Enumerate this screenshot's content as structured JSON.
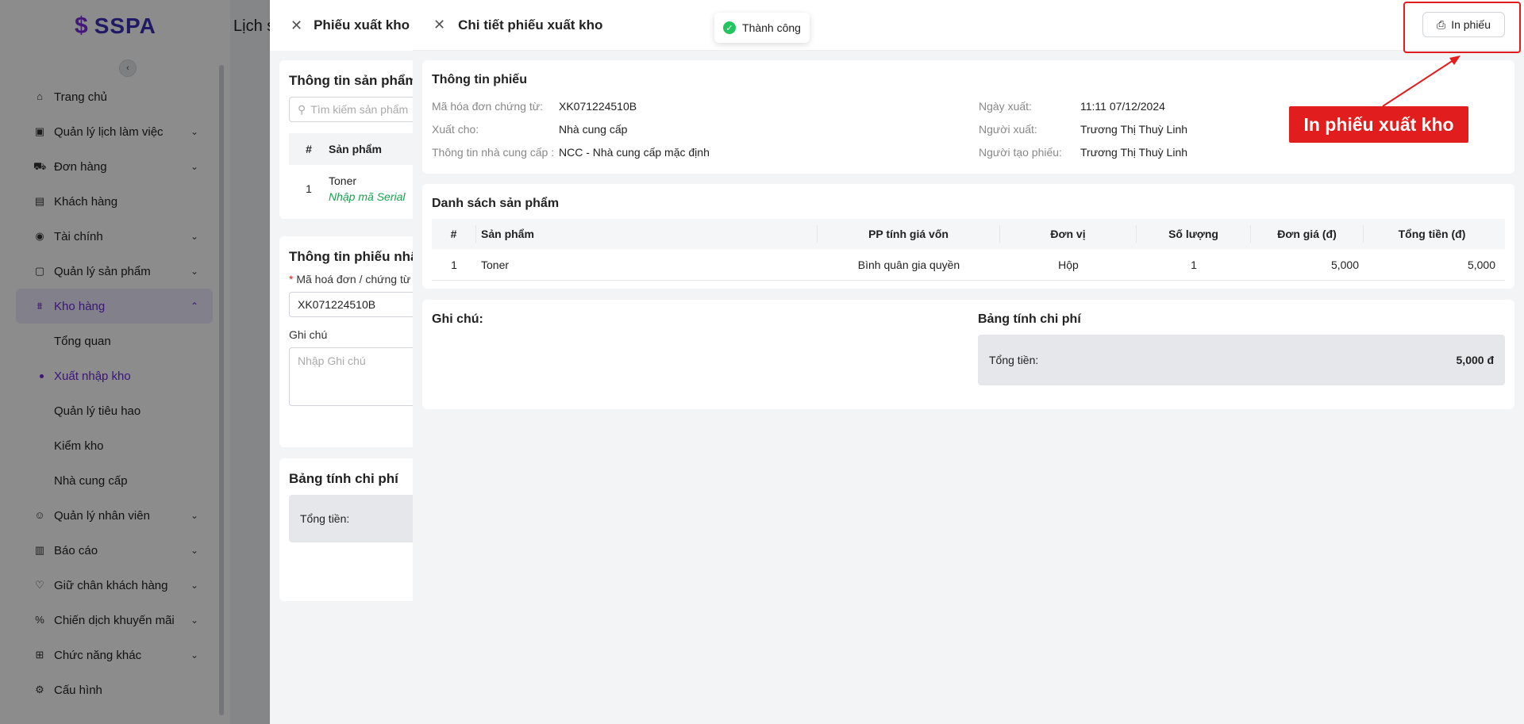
{
  "brand": {
    "name": "SSPA"
  },
  "page": {
    "title": "Lịch s"
  },
  "sidebar": {
    "items": [
      {
        "label": "Trang chủ",
        "icon": "home-icon",
        "chevron": false
      },
      {
        "label": "Quản lý lịch làm việc",
        "icon": "calendar-icon",
        "chevron": true
      },
      {
        "label": "Đơn hàng",
        "icon": "cart-icon",
        "chevron": true
      },
      {
        "label": "Khách hàng",
        "icon": "id-card-icon",
        "chevron": false
      },
      {
        "label": "Tài chính",
        "icon": "coin-icon",
        "chevron": true
      },
      {
        "label": "Quản lý sản phẩm",
        "icon": "box-icon",
        "chevron": true
      },
      {
        "label": "Kho hàng",
        "icon": "warehouse-icon",
        "chevron": true,
        "active": true
      }
    ],
    "sub_items": [
      {
        "label": "Tổng quan"
      },
      {
        "label": "Xuất nhập kho",
        "active": true
      },
      {
        "label": "Quản lý tiêu hao"
      },
      {
        "label": "Kiểm kho"
      },
      {
        "label": "Nhà cung cấp"
      }
    ],
    "items_after": [
      {
        "label": "Quản lý nhân viên",
        "icon": "users-icon",
        "chevron": true
      },
      {
        "label": "Báo cáo",
        "icon": "bar-chart-icon",
        "chevron": true
      },
      {
        "label": "Giữ chân khách hàng",
        "icon": "heart-icon",
        "chevron": true
      },
      {
        "label": "Chiến dịch khuyến mãi",
        "icon": "percent-icon",
        "chevron": true
      },
      {
        "label": "Chức năng khác",
        "icon": "grid-icon",
        "chevron": true
      },
      {
        "label": "Cấu hình",
        "icon": "gear-icon",
        "chevron": false
      }
    ]
  },
  "drawer_back": {
    "title": "Phiếu xuất kho",
    "product_section": "Thông tin sản phẩm",
    "search_placeholder": "Tìm kiếm sản phẩm",
    "col_index": "#",
    "col_product": "Sản phẩm",
    "row": {
      "index": "1",
      "name": "Toner",
      "serial_hint": "Nhập mã Serial"
    },
    "receipt_section": "Thông tin phiếu nhập",
    "invoice_label": "Mã hoá đơn / chứng từ",
    "invoice_value": "XK071224510B",
    "note_label": "Ghi chú",
    "note_placeholder": "Nhập Ghi chú",
    "cost_section": "Bảng tính chi phí",
    "total_label": "Tổng tiền:"
  },
  "detail": {
    "title": "Chi tiết phiếu xuất kho",
    "print_label": "In phiếu",
    "info_section": "Thông tin phiếu",
    "info_left": [
      {
        "key": "Mã hóa đơn chứng từ:",
        "value": "XK071224510B"
      },
      {
        "key": "Xuất cho:",
        "value": "Nhà cung cấp"
      },
      {
        "key": "Thông tin nhà cung cấp :",
        "value": "NCC - Nhà cung cấp mặc định"
      }
    ],
    "info_right": [
      {
        "key": "Ngày xuất:",
        "value": "11:11 07/12/2024"
      },
      {
        "key": "Người xuất:",
        "value": "Trương Thị Thuỳ Linh"
      },
      {
        "key": "Người tạo phiếu:",
        "value": "Trương Thị Thuỳ Linh"
      }
    ],
    "products_section": "Danh sách sản phẩm",
    "columns": [
      "#",
      "Sản phẩm",
      "PP tính giá vốn",
      "Đơn vị",
      "Số lượng",
      "Đơn giá (đ)",
      "Tổng tiền (đ)"
    ],
    "rows": [
      [
        "1",
        "Toner",
        "Bình quân gia quyền",
        "Hộp",
        "1",
        "5,000",
        "5,000"
      ]
    ],
    "note_title": "Ghi chú:",
    "cost_title": "Bảng tính chi phí",
    "total_label": "Tổng tiền:",
    "total_value": "5,000 đ"
  },
  "toast": {
    "text": "Thành công"
  },
  "annotation": {
    "callout": "In phiếu xuất kho"
  },
  "colors": {
    "accent": "#6d28d9",
    "highlight": "#e11d1d",
    "success": "#22c55e"
  }
}
